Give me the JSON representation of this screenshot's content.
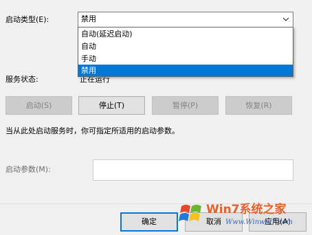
{
  "startup": {
    "label": "启动类型(E):",
    "value": "禁用",
    "options": [
      "自动(延迟启动)",
      "自动",
      "手动",
      "禁用"
    ],
    "selected_index": 3
  },
  "status": {
    "label": "服务状态:",
    "value": "正在运行"
  },
  "buttons": {
    "start": "启动(S)",
    "stop": "停止(T)",
    "pause": "暂停(P)",
    "resume": "恢复(R)"
  },
  "hint": "当从此处启动服务时，你可指定所适用的启动参数。",
  "params": {
    "label": "启动参数(M):",
    "value": ""
  },
  "footer": {
    "ok": "确定",
    "cancel": "取消",
    "apply": "应用(A)"
  },
  "watermark": {
    "brand": "Win7系统之家",
    "url": "Www.Winwin7.com"
  },
  "colors": {
    "selection": "#0078d7",
    "watermark_text": "#e8602c"
  }
}
